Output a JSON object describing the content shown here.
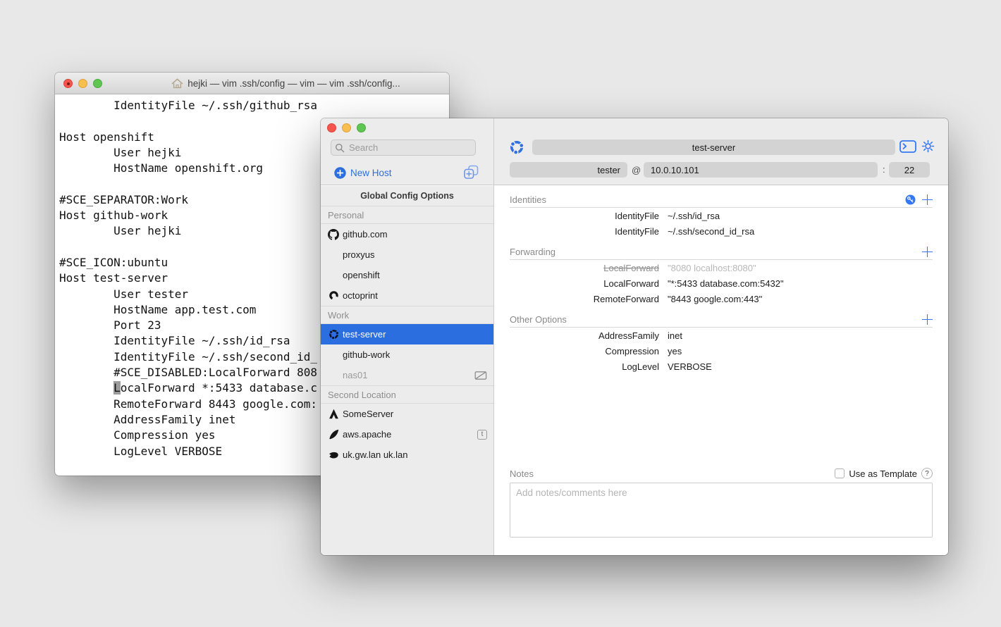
{
  "desktop": {
    "bg": "#e8e8e8"
  },
  "vim": {
    "title": "hejki — vim .ssh/config — vim — vim .ssh/config...",
    "lines_before_cursor": [
      "        IdentityFile ~/.ssh/github_rsa",
      "",
      "Host openshift",
      "        User hejki",
      "        HostName openshift.org",
      "",
      "#SCE_SEPARATOR:Work",
      "Host github-work",
      "        User hejki",
      "",
      "#SCE_ICON:ubuntu",
      "Host test-server",
      "        User tester",
      "        HostName app.test.com",
      "        Port 23",
      "        IdentityFile ~/.ssh/id_rsa",
      "        IdentityFile ~/.ssh/second_id_",
      "        #SCE_DISABLED:LocalForward 808"
    ],
    "cursor_line": {
      "prefix": "        ",
      "char": "L",
      "suffix": "ocalForward *:5433 database.c"
    },
    "lines_after_cursor": [
      "        RemoteForward 8443 google.com:",
      "        AddressFamily inet",
      "        Compression yes",
      "        LogLevel VERBOSE"
    ]
  },
  "app": {
    "search": {
      "placeholder": "Search"
    },
    "new_host_label": "New Host",
    "sidebar": {
      "global_button": "Global Config Options",
      "sections": [
        {
          "label": "Personal",
          "items": [
            {
              "label": "github.com",
              "icon": "github-icon"
            },
            {
              "label": "proxyus"
            },
            {
              "label": "openshift"
            },
            {
              "label": "octoprint",
              "icon": "octoprint-icon"
            }
          ]
        },
        {
          "label": "Work",
          "items": [
            {
              "label": "test-server",
              "icon": "ubuntu-icon",
              "selected": true
            },
            {
              "label": "github-work"
            },
            {
              "label": "nas01",
              "disabled": true,
              "right_icon": "disabled-screen-icon"
            }
          ]
        },
        {
          "label": "Second Location",
          "items": [
            {
              "label": "SomeServer",
              "icon": "arrow-icon"
            },
            {
              "label": "aws.apache",
              "icon": "feather-icon",
              "badge": "t"
            },
            {
              "label": "uk.gw.lan uk.lan",
              "icon": "whale-icon"
            }
          ]
        }
      ]
    },
    "toolbar": {
      "host_alias": "test-server",
      "user": "tester",
      "at": "@",
      "hostname": "10.0.10.101",
      "colon": ":",
      "port": "22"
    },
    "detail": {
      "sections": [
        {
          "title": "Identities",
          "rows": [
            {
              "key": "IdentityFile",
              "value": "~/.ssh/id_rsa"
            },
            {
              "key": "IdentityFile",
              "value": "~/.ssh/second_id_rsa"
            }
          ]
        },
        {
          "title": "Forwarding",
          "rows": [
            {
              "key": "LocalForward",
              "value": "\"8080 localhost:8080\"",
              "disabled": true
            },
            {
              "key": "LocalForward",
              "value": "\"*:5433 database.com:5432\""
            },
            {
              "key": "RemoteForward",
              "value": "\"8443 google.com:443\""
            }
          ]
        },
        {
          "title": "Other Options",
          "rows": [
            {
              "key": "AddressFamily",
              "value": "inet"
            },
            {
              "key": "Compression",
              "value": "yes"
            },
            {
              "key": "LogLevel",
              "value": "VERBOSE"
            }
          ]
        }
      ],
      "notes_label": "Notes",
      "use_as_template_label": "Use as Template",
      "help_label": "?",
      "notes_placeholder": "Add notes/comments here"
    },
    "colors": {
      "accent_blue": "#2d6edf",
      "selection_blue": "#2b6ee0"
    }
  }
}
